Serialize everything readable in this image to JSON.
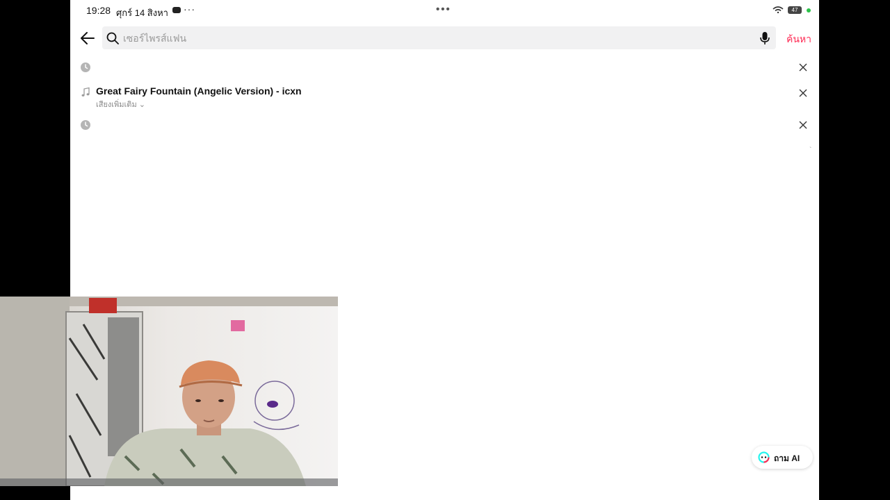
{
  "status_bar": {
    "time": "19:28",
    "date": "ศุกร์ 14 สิงหา",
    "more": "···",
    "dots": "•••",
    "battery": "47"
  },
  "search": {
    "placeholder": "เซอร์ไพรส์แฟน",
    "value": "",
    "submit_label": "ค้นหา"
  },
  "history": [
    {
      "type": "recent",
      "text": ""
    },
    {
      "type": "sound",
      "text": "Great Fairy Fountain (Angelic Version) - icxn",
      "sub": "เสียงเพิ่มเติม ⌄"
    },
    {
      "type": "recent",
      "text": ""
    }
  ],
  "ai_button": {
    "label": "ถาม AI"
  },
  "misc": {
    "tick": "`"
  },
  "colors": {
    "accent": "#fe2c55",
    "status_green": "#2dc24b",
    "searchbar_bg": "#f1f1f2"
  }
}
